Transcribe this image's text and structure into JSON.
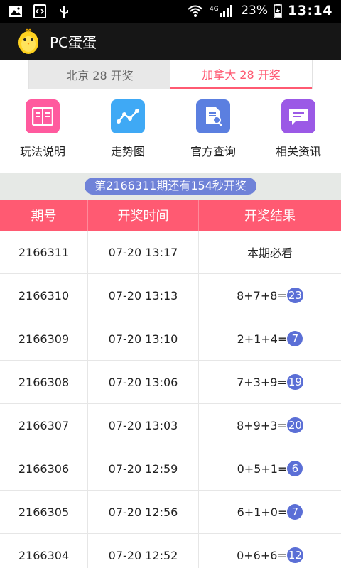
{
  "status_bar": {
    "battery_percent": "23%",
    "time": "13:14",
    "icons": [
      "image-icon",
      "code-icon",
      "usb-icon",
      "wifi-icon",
      "4g-signal-icon",
      "battery-icon"
    ]
  },
  "app": {
    "title": "PC蛋蛋",
    "logo": "chick-logo"
  },
  "tabs": [
    {
      "label": "北京 28 开奖",
      "active": false
    },
    {
      "label": "加拿大 28 开奖",
      "active": true
    }
  ],
  "features": [
    {
      "label": "玩法说明",
      "icon": "book-icon",
      "color": "#ff5a9e"
    },
    {
      "label": "走势图",
      "icon": "trend-icon",
      "color": "#3fa9f5"
    },
    {
      "label": "官方查询",
      "icon": "doc-search-icon",
      "color": "#5b7fe0"
    },
    {
      "label": "相关资讯",
      "icon": "news-icon",
      "color": "#9b59e6"
    }
  ],
  "countdown": "第2166311期还有154秒开奖",
  "table": {
    "headers": [
      "期号",
      "开奖时间",
      "开奖结果"
    ],
    "rows": [
      {
        "issue": "2166311",
        "time": "07-20 13:17",
        "expr": "本期必看",
        "sum": ""
      },
      {
        "issue": "2166310",
        "time": "07-20 13:13",
        "expr": "8+7+8=",
        "sum": "23"
      },
      {
        "issue": "2166309",
        "time": "07-20 13:10",
        "expr": "2+1+4=",
        "sum": "7"
      },
      {
        "issue": "2166308",
        "time": "07-20 13:06",
        "expr": "7+3+9=",
        "sum": "19"
      },
      {
        "issue": "2166307",
        "time": "07-20 13:03",
        "expr": "8+9+3=",
        "sum": "20"
      },
      {
        "issue": "2166306",
        "time": "07-20 12:59",
        "expr": "0+5+1=",
        "sum": "6"
      },
      {
        "issue": "2166305",
        "time": "07-20 12:56",
        "expr": "6+1+0=",
        "sum": "7"
      },
      {
        "issue": "2166304",
        "time": "07-20 12:52",
        "expr": "0+6+6=",
        "sum": "12"
      }
    ]
  },
  "colors": {
    "accent": "#ff5a72",
    "ball": "#5b6fd6",
    "pill": "#6f82d8"
  }
}
